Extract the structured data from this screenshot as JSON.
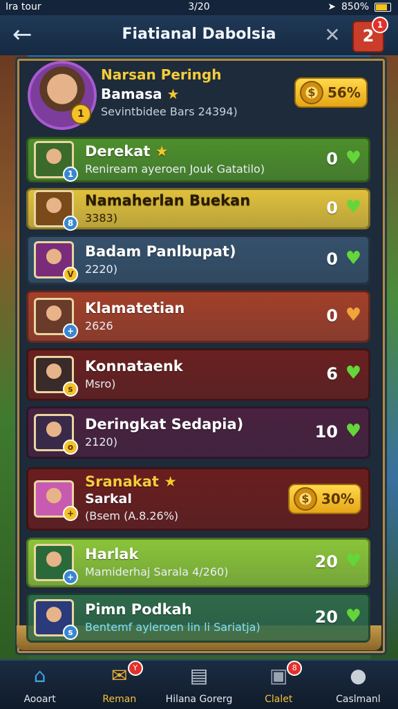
{
  "status": {
    "carrier": "Ira tour",
    "time": "3/20",
    "battery": "850%"
  },
  "header": {
    "title": "Fiatianal Dabolsia",
    "notification_count": "2",
    "notification_badge": "1"
  },
  "profile": {
    "name": "Narsan Peringh",
    "subtitle": "Bamasa",
    "meta": "Sevintbidee Bars 24394)",
    "level": "1",
    "coins": "56%"
  },
  "rows": [
    {
      "name": "Derekat",
      "star": true,
      "sub": "Reniream ayeroen Jouk Gatatilo)",
      "score": "0",
      "heart": "green",
      "badge": "1",
      "color": "#4e8f2c"
    },
    {
      "name": "Namaherlan Buekan",
      "sub": "3383)",
      "score": "0",
      "heart": "green",
      "badge": "8",
      "color": "#e0c03c"
    },
    {
      "name": "Badam Panlbupat)",
      "sub": "2220)",
      "score": "0",
      "heart": "green",
      "badge": "V",
      "color": "#36516b"
    },
    {
      "name": "Klamatetian",
      "sub": "2626",
      "score": "0",
      "heart": "orange",
      "badge": "+",
      "color": "#a3402a"
    },
    {
      "name": "Konnataenk",
      "sub": "Msro)",
      "score": "6",
      "heart": "green",
      "badge": "s",
      "color": "#6a2020"
    },
    {
      "name": "Deringkat Sedapia)",
      "sub": "2120)",
      "score": "10",
      "heart": "green",
      "badge": "o",
      "color": "#4a2240"
    },
    {
      "name": "Sranakat",
      "star": true,
      "line2": "Sarkal",
      "sub": "(Bsem (A.8.26%)",
      "score": "30%",
      "heart": "",
      "badge": "+",
      "color": "#6a1e1e"
    },
    {
      "name": "Harlak",
      "sub": "Mamiderhaj Sarala 4/260)",
      "score": "20",
      "heart": "green",
      "badge": "+",
      "color": "#8bc43a"
    },
    {
      "name": "Pimn Podkah",
      "sub": "Bentemf ayleroen lin li Sariatja)",
      "score": "20",
      "heart": "green",
      "badge": "s",
      "color": "#2f6a4a"
    }
  ],
  "nav": [
    {
      "label": "Aooart",
      "icon": "home-icon"
    },
    {
      "label": "Reman",
      "icon": "mail-icon",
      "badge": "Y",
      "active": true
    },
    {
      "label": "Hilana Gorerg",
      "icon": "shop-icon",
      "badge": ""
    },
    {
      "label": "Clalet",
      "icon": "box-icon",
      "badge": "8",
      "active": true
    },
    {
      "label": "Caslmanl",
      "icon": "user-icon"
    }
  ],
  "colors": {
    "accent": "#f3c33a",
    "panel": "#1d2b3a",
    "heart_green": "#64d63a",
    "heart_orange": "#f0a43a"
  }
}
